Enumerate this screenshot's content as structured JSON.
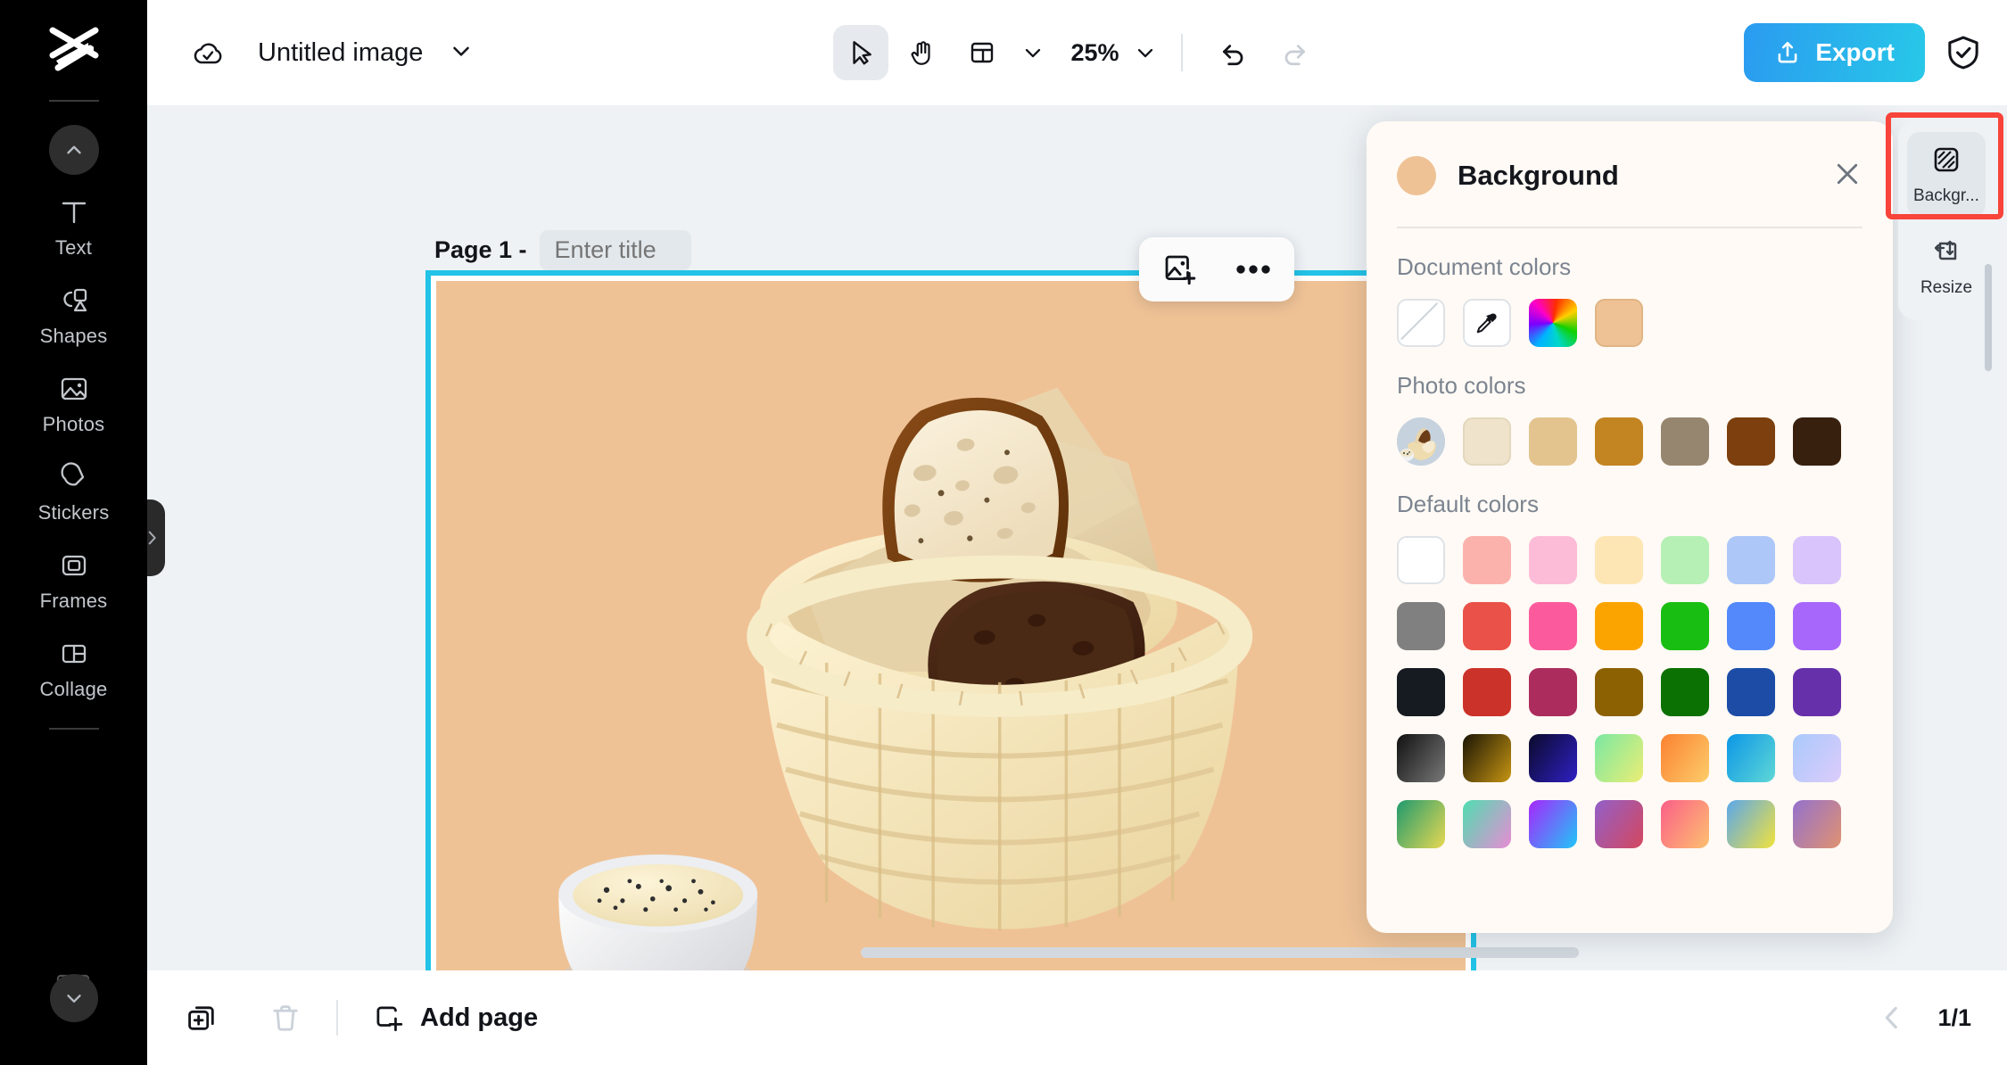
{
  "app": {
    "logo_icon": "capcut-logo-icon"
  },
  "sidebar": {
    "collapse_icon": "chevron-up-icon",
    "expand_icon": "chevron-down-icon",
    "drawer_icon": "chevron-right-icon",
    "items": [
      {
        "label": "Text",
        "icon": "text-icon"
      },
      {
        "label": "Shapes",
        "icon": "shapes-icon"
      },
      {
        "label": "Photos",
        "icon": "photos-icon"
      },
      {
        "label": "Stickers",
        "icon": "stickers-icon"
      },
      {
        "label": "Frames",
        "icon": "frames-icon"
      },
      {
        "label": "Collage",
        "icon": "collage-icon"
      }
    ]
  },
  "topbar": {
    "cloud_icon": "cloud-check-icon",
    "doc_title": "Untitled image",
    "title_caret_icon": "chevron-down-icon",
    "tools": [
      {
        "name": "select-tool",
        "icon": "cursor-arrow-icon",
        "active": true
      },
      {
        "name": "hand-tool",
        "icon": "hand-icon",
        "active": false
      }
    ],
    "layout_icon": "layout-icon",
    "layout_caret_icon": "chevron-down-icon",
    "zoom_value": "25%",
    "zoom_caret_icon": "chevron-down-icon",
    "undo_icon": "undo-icon",
    "redo_icon": "redo-icon",
    "export_label": "Export",
    "export_icon": "upload-icon",
    "shield_icon": "shield-check-icon",
    "export_gradient_from": "#2a9bf0",
    "export_gradient_to": "#28c8e8"
  },
  "canvas": {
    "page_label": "Page 1 -",
    "title_placeholder": "Enter title",
    "title_value": "",
    "background_color": "#efc296",
    "selection_color": "#22c3e6",
    "toolbar": {
      "add_image_icon": "add-image-icon",
      "more_icon": "more-horizontal-icon"
    },
    "artwork_alt": "bread basket with slices and butter ramekin"
  },
  "background_panel": {
    "title": "Background",
    "current_color": "#efc296",
    "close_icon": "close-icon",
    "sections": [
      {
        "title": "Document colors"
      },
      {
        "title": "Photo colors"
      },
      {
        "title": "Default colors"
      }
    ],
    "document_colors": [
      {
        "name": "no-color",
        "type": "none"
      },
      {
        "name": "eyedropper",
        "type": "eyedropper"
      },
      {
        "name": "color-picker",
        "type": "rainbow"
      },
      {
        "name": "current-color",
        "type": "solid",
        "hex": "#efc296"
      }
    ],
    "photo_colors": [
      {
        "name": "photo-thumbnail",
        "type": "thumbnail"
      },
      {
        "name": "cream",
        "type": "solid",
        "hex": "#efe3cb"
      },
      {
        "name": "tan",
        "type": "solid",
        "hex": "#e3c48f"
      },
      {
        "name": "golden-brown",
        "type": "solid",
        "hex": "#c38422"
      },
      {
        "name": "taupe",
        "type": "solid",
        "hex": "#97866f"
      },
      {
        "name": "brown",
        "type": "solid",
        "hex": "#7c3f0d"
      },
      {
        "name": "dark-brown",
        "type": "solid",
        "hex": "#38200f"
      }
    ],
    "default_colors": [
      [
        {
          "hex": "#ffffff"
        },
        {
          "hex": "#fcb2ac"
        },
        {
          "hex": "#fcbcd8"
        },
        {
          "hex": "#fde6b4"
        },
        {
          "hex": "#b6f0b4"
        },
        {
          "hex": "#adc8f8"
        },
        {
          "hex": "#d9c4fb"
        }
      ],
      [
        {
          "hex": "#808080"
        },
        {
          "hex": "#ea5148"
        },
        {
          "hex": "#fb5b9c"
        },
        {
          "hex": "#fba400"
        },
        {
          "hex": "#19be12"
        },
        {
          "hex": "#5389fb"
        },
        {
          "hex": "#a867fb"
        }
      ],
      [
        {
          "hex": "#161b22"
        },
        {
          "hex": "#cb322a"
        },
        {
          "hex": "#ac2c5e"
        },
        {
          "hex": "#8c6102"
        },
        {
          "hex": "#0b7103"
        },
        {
          "hex": "#1c4ca6"
        },
        {
          "hex": "#6730ab"
        }
      ],
      [
        {
          "gradient": [
            "#111111",
            "#787878"
          ]
        },
        {
          "gradient": [
            "#1b1505",
            "#c69512"
          ]
        },
        {
          "gradient": [
            "#0b0a2b",
            "#2f20c4"
          ]
        },
        {
          "gradient": [
            "#7ae8a3",
            "#ebee74"
          ]
        },
        {
          "gradient": [
            "#fb8131",
            "#fdcd6a"
          ]
        },
        {
          "gradient": [
            "#0c96e7",
            "#5fd8d6"
          ]
        },
        {
          "gradient": [
            "#a9c9fb",
            "#dcccfb"
          ]
        }
      ],
      [
        {
          "gradient": [
            "#1f9a6e",
            "#e8d852"
          ]
        },
        {
          "gradient": [
            "#4fddb0",
            "#e88cd4"
          ]
        },
        {
          "gradient": [
            "#a726fb",
            "#1fc7f7"
          ]
        },
        {
          "gradient": [
            "#9260c9",
            "#d4475e"
          ]
        },
        {
          "gradient": [
            "#fb5f88",
            "#fcc070"
          ]
        },
        {
          "gradient": [
            "#5aa7ec",
            "#f2e23d"
          ]
        },
        {
          "gradient": [
            "#9471cd",
            "#e09270"
          ]
        }
      ]
    ]
  },
  "right_dock": {
    "items": [
      {
        "label": "Backgr...",
        "icon": "background-icon",
        "active": true
      },
      {
        "label": "Resize",
        "icon": "resize-icon",
        "active": false
      }
    ],
    "highlight_color": "#f8443a"
  },
  "bottombar": {
    "duplicate_icon": "duplicate-icon",
    "delete_icon": "trash-icon",
    "add_page_label": "Add page",
    "add_page_icon": "add-page-icon",
    "prev_icon": "chevron-left-icon",
    "page_count": "1/1"
  }
}
